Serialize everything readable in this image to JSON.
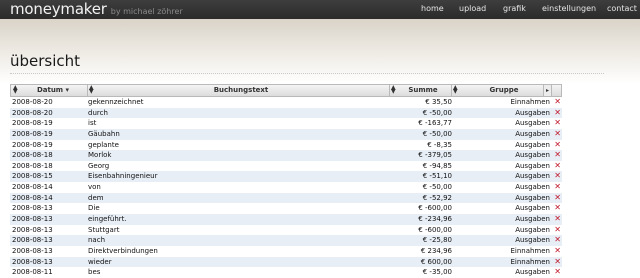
{
  "brand": {
    "name": "moneymaker",
    "byline": "by michael zöhrer"
  },
  "nav": [
    {
      "label": "home"
    },
    {
      "label": "upload"
    },
    {
      "label": "grafik"
    },
    {
      "label": "einstellungen"
    },
    {
      "label": "contact"
    }
  ],
  "page": {
    "title": "übersicht"
  },
  "table": {
    "columns": [
      "Datum",
      "Buchungstext",
      "Summe",
      "Gruppe"
    ],
    "rows": [
      {
        "date": "2008-08-20",
        "text": "gekennzeichnet",
        "sum": "€ 35,50",
        "group": "Einnahmen"
      },
      {
        "date": "2008-08-20",
        "text": "durch",
        "sum": "€ -50,00",
        "group": "Ausgaben"
      },
      {
        "date": "2008-08-19",
        "text": "ist",
        "sum": "€ -163,77",
        "group": "Ausgaben"
      },
      {
        "date": "2008-08-19",
        "text": "Gäubahn",
        "sum": "€ -50,00",
        "group": "Ausgaben"
      },
      {
        "date": "2008-08-19",
        "text": "geplante",
        "sum": "€ -8,35",
        "group": "Ausgaben"
      },
      {
        "date": "2008-08-18",
        "text": "Morlok",
        "sum": "€ -379,05",
        "group": "Ausgaben"
      },
      {
        "date": "2008-08-18",
        "text": "Georg",
        "sum": "€ -94,85",
        "group": "Ausgaben"
      },
      {
        "date": "2008-08-15",
        "text": "Eisenbahningenieur",
        "sum": "€ -51,10",
        "group": "Ausgaben"
      },
      {
        "date": "2008-08-14",
        "text": "von",
        "sum": "€ -50,00",
        "group": "Ausgaben"
      },
      {
        "date": "2008-08-14",
        "text": "dem",
        "sum": "€ -52,92",
        "group": "Ausgaben"
      },
      {
        "date": "2008-08-13",
        "text": "Die",
        "sum": "€ -600,00",
        "group": "Ausgaben"
      },
      {
        "date": "2008-08-13",
        "text": "eingeführt.",
        "sum": "€ -234,96",
        "group": "Ausgaben"
      },
      {
        "date": "2008-08-13",
        "text": "Stuttgart",
        "sum": "€ -600,00",
        "group": "Ausgaben"
      },
      {
        "date": "2008-08-13",
        "text": "nach",
        "sum": "€ -25,80",
        "group": "Ausgaben"
      },
      {
        "date": "2008-08-13",
        "text": "Direktverbindungen",
        "sum": "€ 234,96",
        "group": "Einnahmen"
      },
      {
        "date": "2008-08-13",
        "text": "wieder",
        "sum": "€ 600,00",
        "group": "Einnahmen"
      },
      {
        "date": "2008-08-11",
        "text": "bes",
        "sum": "€ -35,00",
        "group": "Ausgaben"
      }
    ]
  },
  "icons": {
    "delete": "delete-x-icon",
    "column-chooser": "column-chooser-icon",
    "sort": "sort-arrows-icon"
  },
  "colors": {
    "row_alt": "#e7eef6",
    "delete": "#c0162a",
    "topbar": "#333333"
  }
}
